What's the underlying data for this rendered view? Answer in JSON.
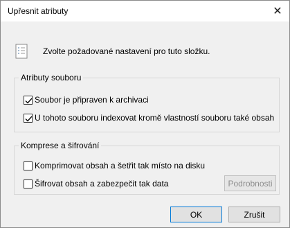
{
  "window": {
    "title": "Upřesnit atributy",
    "close_glyph": "✕"
  },
  "header": {
    "text": "Zvolte požadované nastavení pro tuto složku.",
    "icon": "document-list-icon"
  },
  "groups": {
    "attributes": {
      "legend": "Atributy souboru",
      "archive_label": "Soubor je připraven k archivaci",
      "archive_checked": true,
      "index_label": "U tohoto souboru indexovat kromě vlastností souboru také obsah",
      "index_checked": true
    },
    "compression": {
      "legend": "Komprese a šifrování",
      "compress_label": "Komprimovat obsah a šetřit tak místo na disku",
      "compress_checked": false,
      "encrypt_label": "Šifrovat obsah a zabezpečit tak data",
      "encrypt_checked": false,
      "details_label": "Podrobnosti"
    }
  },
  "buttons": {
    "ok_label": "OK",
    "cancel_label": "Zrušit"
  }
}
